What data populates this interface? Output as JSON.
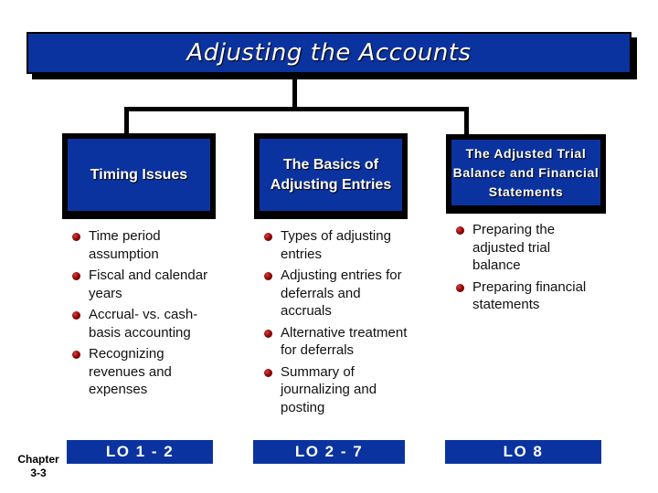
{
  "title": "Adjusting the Accounts",
  "colors": {
    "box_fill": "#0b33a0",
    "border": "#000000",
    "bullet": "#8b0000",
    "box_text": "#ffffff"
  },
  "columns": [
    {
      "heading": "Timing Issues",
      "items": [
        "Time period assumption",
        "Fiscal and calendar years",
        "Accrual- vs. cash-basis accounting",
        "Recognizing revenues and expenses"
      ],
      "lo": "LO 1 - 2"
    },
    {
      "heading": "The Basics of Adjusting Entries",
      "items": [
        "Types of adjusting entries",
        "Adjusting entries for deferrals and accruals",
        "Alternative treatment for deferrals",
        "Summary of journalizing and posting"
      ],
      "lo": "LO 2 - 7"
    },
    {
      "heading": "The Adjusted Trial Balance and Financial Statements",
      "items": [
        "Preparing the adjusted trial balance",
        "Preparing financial statements"
      ],
      "lo": "LO 8"
    }
  ],
  "footer": {
    "chapter_label": "Chapter",
    "chapter_number": "3-3"
  }
}
